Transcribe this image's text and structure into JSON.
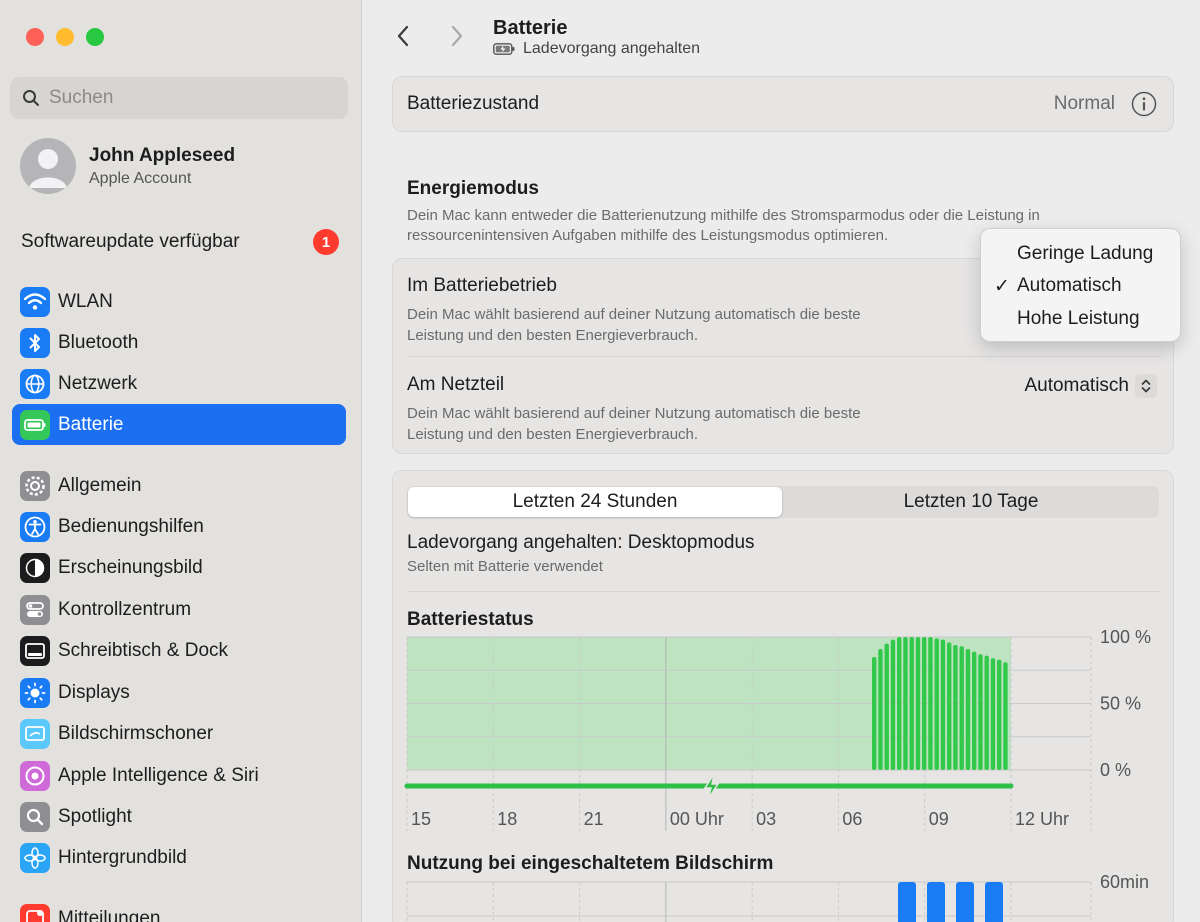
{
  "sidebar": {
    "search_placeholder": "Suchen",
    "account": {
      "name": "John Appleseed",
      "subtitle": "Apple Account"
    },
    "update": {
      "label": "Softwareupdate verfügbar",
      "badge": "1"
    },
    "items": [
      {
        "label": "WLAN",
        "icon": "wifi-icon",
        "color": "#1a7cf5"
      },
      {
        "label": "Bluetooth",
        "icon": "bluetooth-icon",
        "color": "#1a7cf5"
      },
      {
        "label": "Netzwerk",
        "icon": "globe-icon",
        "color": "#1a7cf5"
      },
      {
        "label": "Batterie",
        "icon": "battery-icon",
        "color": "#34c759",
        "active": true
      },
      {
        "label": "Allgemein",
        "icon": "gear-icon",
        "color": "#8e8e93"
      },
      {
        "label": "Bedienungshilfen",
        "icon": "accessibility-icon",
        "color": "#1a7cf5"
      },
      {
        "label": "Erscheinungsbild",
        "icon": "appearance-icon",
        "color": "#1c1c1e"
      },
      {
        "label": "Kontrollzentrum",
        "icon": "control-center-icon",
        "color": "#8e8e93"
      },
      {
        "label": "Schreibtisch & Dock",
        "icon": "dock-icon",
        "color": "#1c1c1e"
      },
      {
        "label": "Displays",
        "icon": "sun-icon",
        "color": "#1a7cf5"
      },
      {
        "label": "Bildschirmschoner",
        "icon": "screensaver-icon",
        "color": "#5ac8fa"
      },
      {
        "label": "Apple Intelligence & Siri",
        "icon": "siri-icon",
        "color": "#d06ad8"
      },
      {
        "label": "Spotlight",
        "icon": "magnifier-icon",
        "color": "#8e8e93"
      },
      {
        "label": "Hintergrundbild",
        "icon": "flower-icon",
        "color": "#2aa4f4"
      },
      {
        "label": "Mitteilungen",
        "icon": "notifications-icon",
        "color": "#ff3b30"
      }
    ]
  },
  "header": {
    "title": "Batterie",
    "subtitle": "Ladevorgang angehalten"
  },
  "health": {
    "label": "Batteriezustand",
    "value": "Normal"
  },
  "energy": {
    "title": "Energiemodus",
    "description": "Dein Mac kann entweder die Batterienutzung mithilfe des Stromsparmodus oder die Leistung in ressourcenintensiven Aufgaben mithilfe des Leistungsmodus optimieren.",
    "battery_mode": {
      "label": "Im Batteriebetrieb",
      "description_line1": "Dein Mac wählt basierend auf deiner Nutzung automatisch die beste",
      "description_line2": "Leistung und den besten Energieverbrauch."
    },
    "power_mode": {
      "label": "Am Netzteil",
      "description_line1": "Dein Mac wählt basierend auf deiner Nutzung automatisch die beste",
      "description_line2": "Leistung und den besten Energieverbrauch.",
      "value": "Automatisch"
    },
    "popup": {
      "options": [
        "Geringe Ladung",
        "Automatisch",
        "Hohe Leistung"
      ],
      "checked": "Automatisch",
      "checkmark": "✓"
    }
  },
  "usage": {
    "tabs": [
      "Letzten 24 Stunden",
      "Letzten 10 Tage"
    ],
    "selected_tab": "Letzten 24 Stunden",
    "status": "Ladevorgang angehalten: Desktopmodus",
    "status_sub": "Selten mit Batterie verwendet"
  },
  "chart_data": [
    {
      "type": "bar",
      "title": "Batteriestatus",
      "x_ticks": [
        "15",
        "18",
        "21",
        "00 Uhr",
        "03",
        "06",
        "09",
        "12 Uhr"
      ],
      "y_ticks": [
        "100 %",
        "50 %",
        "0 %"
      ],
      "ylim": [
        0,
        100
      ],
      "charging_band": true,
      "series": [
        {
          "values": [
            85,
            91,
            95,
            98,
            100,
            100,
            100,
            100,
            100,
            100,
            99,
            98,
            96,
            94,
            93,
            91,
            89,
            87,
            86,
            84,
            83,
            81
          ]
        }
      ],
      "colors": {
        "bars": "#32c94a",
        "band": "#bde3c0",
        "charge_line": "#2fbf48"
      }
    },
    {
      "type": "bar",
      "title": "Nutzung bei eingeschaltetem Bildschirm",
      "y_ticks": [
        "60min"
      ],
      "series": [
        {
          "values": [
            60,
            60,
            60,
            60
          ]
        }
      ],
      "colors": {
        "bars": "#1a7cf5"
      }
    }
  ]
}
